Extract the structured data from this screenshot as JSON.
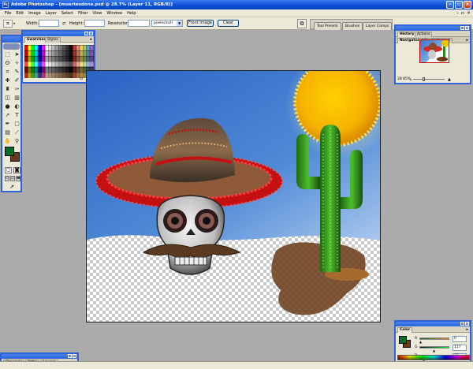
{
  "app": {
    "title": "Adobe Photoshop - [muertesdone.psd @ 28.7% (Layer 11, RGB/8)]",
    "icon_label": "Ps"
  },
  "menu": [
    "File",
    "Edit",
    "Image",
    "Layer",
    "Select",
    "Filter",
    "View",
    "Window",
    "Help"
  ],
  "options": {
    "width_label": "Width:",
    "height_label": "Height:",
    "resolution_label": "Resolution:",
    "units": "pixels/inch",
    "front_image": "Front Image",
    "clear": "Clear",
    "swap": "⇄"
  },
  "well_tabs": [
    "Tool Presets",
    "Brushes",
    "Layer Comps"
  ],
  "palettes": {
    "swatches": {
      "tabs": [
        "Swatches",
        "Styles"
      ]
    },
    "navigator": {
      "top_tabs": [
        "History",
        "Actions"
      ],
      "tabs": [
        "Navigator",
        "Info",
        "Histogram"
      ],
      "zoom": "28.85%"
    },
    "color": {
      "title": "Color",
      "rows": [
        {
          "label": "R",
          "value": "0"
        },
        {
          "label": "G",
          "value": "117"
        },
        {
          "label": "B",
          "value": "32"
        }
      ]
    },
    "layers": {
      "tabs": [
        "Channels",
        "Paths",
        "Layers"
      ]
    }
  },
  "colors": {
    "foreground": "#0b6e20",
    "background": "#6b3a16",
    "title_bar": "#0a4cd4",
    "palette_border": "#3162d6"
  },
  "icons": {
    "tools": [
      "marquee-icon",
      "move-icon",
      "lasso-icon",
      "magic-wand-icon",
      "crop-icon",
      "slice-icon",
      "healing-icon",
      "brush-icon",
      "clone-stamp-icon",
      "history-brush-icon",
      "eraser-icon",
      "gradient-icon",
      "blur-icon",
      "dodge-icon",
      "path-select-icon",
      "type-icon",
      "pen-icon",
      "shape-icon",
      "notes-icon",
      "eyedropper-icon",
      "hand-icon",
      "zoom-icon"
    ]
  }
}
